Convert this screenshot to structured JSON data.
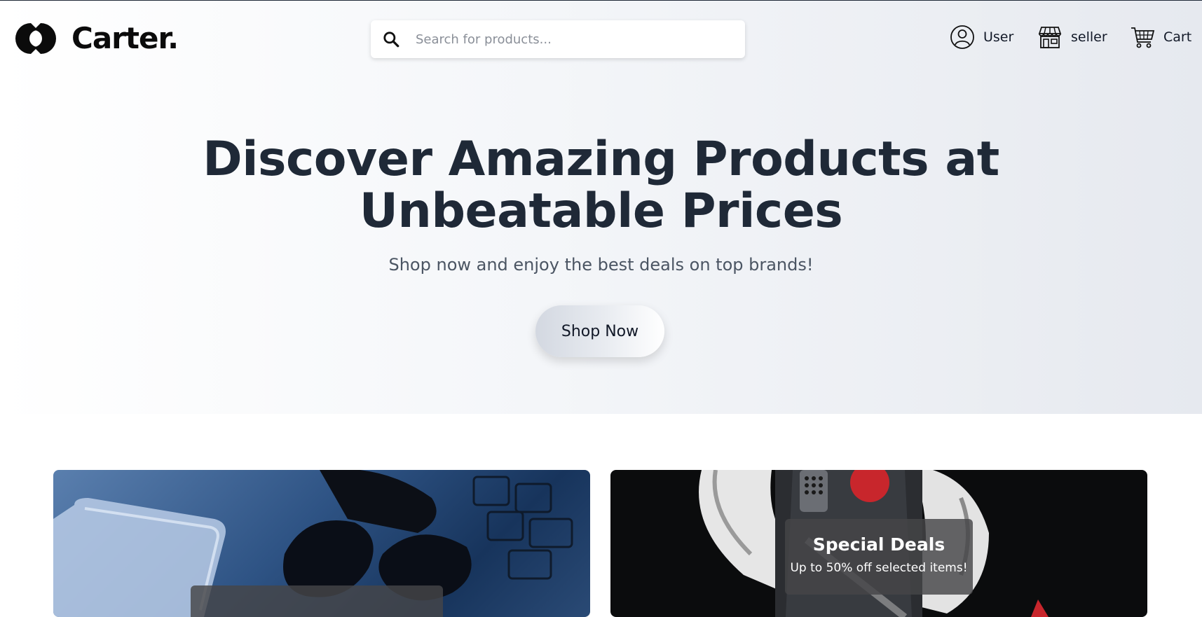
{
  "brand": {
    "name": "Carter.",
    "logo_icon": "carter-logo-icon"
  },
  "search": {
    "placeholder": "Search for products...",
    "value": "",
    "icon": "search-icon"
  },
  "nav": {
    "user": {
      "label": "User",
      "icon": "user-icon"
    },
    "seller": {
      "label": "seller",
      "icon": "store-icon"
    },
    "cart": {
      "label": "Cart",
      "icon": "cart-icon"
    }
  },
  "hero": {
    "title_line1": "Discover Amazing Products at",
    "title_line2": "Unbeatable Prices",
    "subtitle": "Shop now and enjoy the best deals on top brands!",
    "cta_label": "Shop Now"
  },
  "promo_cards": [
    {
      "title": "",
      "subtitle": "",
      "image": "earbuds-on-laptop-image"
    },
    {
      "title": "Special Deals",
      "subtitle": "Up to 50% off selected items!",
      "image": "headphones-product-image"
    }
  ],
  "colors": {
    "text_dark": "#1f2937",
    "hero_bg_end": "#e6e9ef",
    "overlay": "#464648"
  }
}
